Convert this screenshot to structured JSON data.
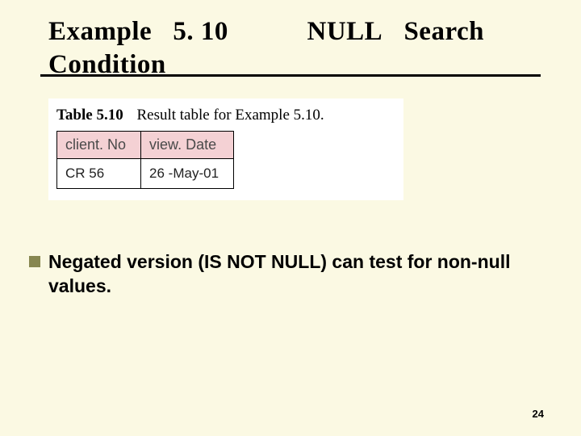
{
  "title": {
    "left1": "Example",
    "left2": "5. 10",
    "rightA": "NULL",
    "rightB": "Search",
    "line2": "Condition"
  },
  "table": {
    "label": "Table 5.10",
    "caption": "Result table for Example 5.10.",
    "headers": {
      "col1": "client. No",
      "col2": "view. Date"
    },
    "row": {
      "col1": "CR 56",
      "col2": "26 -May-01"
    }
  },
  "bullet": {
    "text": "Negated version (IS NOT NULL) can test for non-null values."
  },
  "pageNumber": "24"
}
